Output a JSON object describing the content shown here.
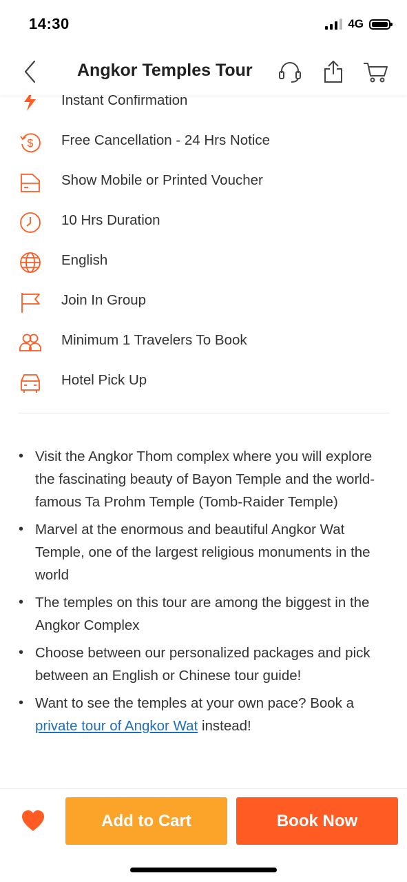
{
  "status": {
    "time": "14:30",
    "network": "4G"
  },
  "header": {
    "title": "Angkor Temples Tour"
  },
  "features": [
    {
      "icon": "lightning-icon",
      "label": "Instant Confirmation"
    },
    {
      "icon": "refund-dollar-icon",
      "label": "Free Cancellation - 24 Hrs Notice"
    },
    {
      "icon": "voucher-icon",
      "label": "Show Mobile or Printed Voucher"
    },
    {
      "icon": "clock-icon",
      "label": "10 Hrs Duration"
    },
    {
      "icon": "globe-icon",
      "label": "English"
    },
    {
      "icon": "flag-icon",
      "label": "Join In Group"
    },
    {
      "icon": "group-icon",
      "label": "Minimum 1 Travelers To Book"
    },
    {
      "icon": "car-icon",
      "label": "Hotel Pick Up"
    }
  ],
  "highlights": [
    {
      "text": "Visit the Angkor Thom complex where you will explore the fascinating beauty of Bayon Temple and the world-famous Ta Prohm Temple (Tomb-Raider Temple)"
    },
    {
      "text": "Marvel at the enormous and beautiful Angkor Wat Temple, one of the largest religious monuments in the world"
    },
    {
      "text": "The temples on this tour are among the biggest in the Angkor Complex"
    },
    {
      "text": "Choose between our personalized packages and pick between an English or Chinese tour guide!"
    },
    {
      "text": "Want to see the temples at your own pace? Book a ",
      "link": "private tour of Angkor Wat",
      "after": " instead!"
    }
  ],
  "actions": {
    "add_to_cart": "Add to Cart",
    "book_now": "Book Now"
  },
  "colors": {
    "accent": "#ff5b22",
    "cart": "#fca32a",
    "link": "#1f6fb8"
  }
}
